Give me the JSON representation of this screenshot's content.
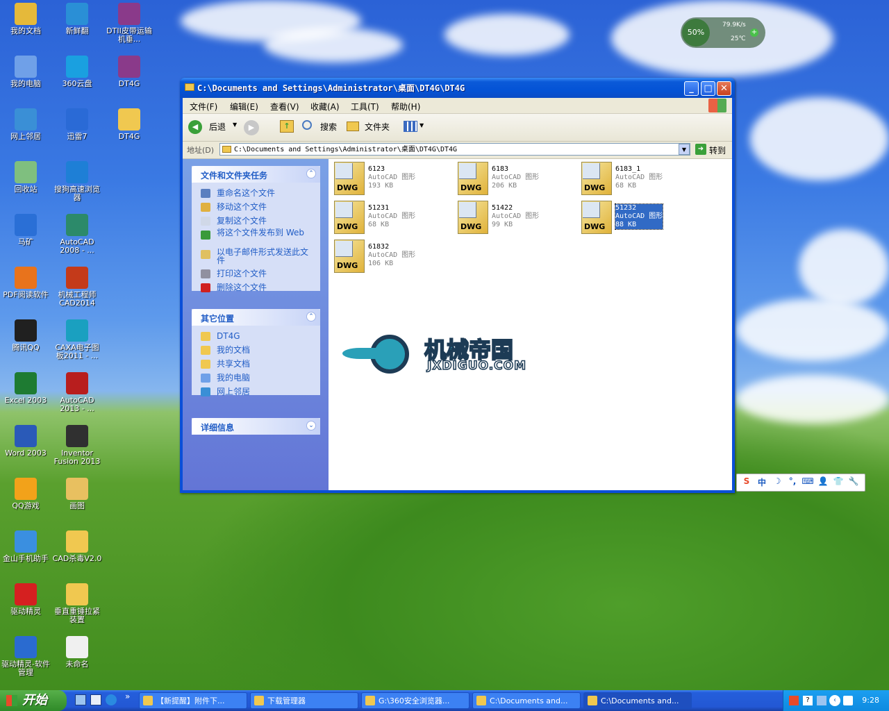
{
  "desktop": {
    "icons_col1": [
      {
        "label": "我的文档",
        "color": "#e5b93a"
      },
      {
        "label": "我的电脑",
        "color": "#6fa0e8"
      },
      {
        "label": "网上邻居",
        "color": "#3a8fd6"
      },
      {
        "label": "回收站",
        "color": "#7fbf7f"
      },
      {
        "label": "马矿",
        "color": "#2a6fd6"
      },
      {
        "label": "PDF阅读软件",
        "color": "#e8731c"
      },
      {
        "label": "腾讯QQ",
        "color": "#202020"
      },
      {
        "label": "Excel 2003",
        "color": "#1e7b32"
      },
      {
        "label": "Word 2003",
        "color": "#2a5ab8"
      },
      {
        "label": "QQ游戏",
        "color": "#f2a21a"
      },
      {
        "label": "金山手机助手",
        "color": "#3a8fe0"
      },
      {
        "label": "驱动精灵",
        "color": "#d52020"
      },
      {
        "label": "驱动精灵-软件管理",
        "color": "#2a6bd0"
      }
    ],
    "icons_col2": [
      {
        "label": "新鲜翻",
        "color": "#2a8fd6"
      },
      {
        "label": "360云盘",
        "color": "#1aa0e0"
      },
      {
        "label": "迅雷7",
        "color": "#2a6ad6"
      },
      {
        "label": "搜狗高速浏览器",
        "color": "#1e7fd6"
      },
      {
        "label": "AutoCAD 2008 - ...",
        "color": "#2c8a6a"
      },
      {
        "label": "机械工程师CAD2014",
        "color": "#c43a1a"
      },
      {
        "label": "CAXA电子图板2011 - ...",
        "color": "#1aa0c0"
      },
      {
        "label": "AutoCAD 2013 - ...",
        "color": "#b81e1e"
      },
      {
        "label": "Inventor Fusion 2013",
        "color": "#303030"
      },
      {
        "label": "画图",
        "color": "#e8c060"
      },
      {
        "label": "CAD杀毒V2.0",
        "color": "#f0c850"
      },
      {
        "label": "垂直重锤拉紧装置",
        "color": "#f0c850"
      },
      {
        "label": "未命名",
        "color": "#f0f0f0"
      }
    ],
    "icons_col3": [
      {
        "label": "DTII皮带运输机垂...",
        "color": "#8a3a8a"
      },
      {
        "label": "DT4G",
        "color": "#8a3a8a"
      },
      {
        "label": "DT4G",
        "color": "#f0c850"
      }
    ]
  },
  "gadget": {
    "cpu": "50%",
    "net": "79.9K/s",
    "temp": "25℃"
  },
  "window": {
    "title": "C:\\Documents and Settings\\Administrator\\桌面\\DT4G\\DT4G",
    "menus": [
      "文件(F)",
      "编辑(E)",
      "查看(V)",
      "收藏(A)",
      "工具(T)",
      "帮助(H)"
    ],
    "toolbar": {
      "back": "后退",
      "search": "搜索",
      "folders": "文件夹"
    },
    "address": {
      "label": "地址(D)",
      "value": "C:\\Documents and Settings\\Administrator\\桌面\\DT4G\\DT4G",
      "go": "转到"
    },
    "tasks": {
      "title": "文件和文件夹任务",
      "items": [
        {
          "label": "重命名这个文件",
          "color": "#5a7fc0"
        },
        {
          "label": "移动这个文件",
          "color": "#e0b040"
        },
        {
          "label": "复制这个文件",
          "color": "#d0d8e8"
        },
        {
          "label": "将这个文件发布到 Web",
          "color": "#3a9a3a"
        },
        {
          "label": "以电子邮件形式发送此文件",
          "color": "#e0c060"
        },
        {
          "label": "打印这个文件",
          "color": "#9090a0"
        },
        {
          "label": "删除这个文件",
          "color": "#d02020"
        }
      ]
    },
    "places": {
      "title": "其它位置",
      "items": [
        {
          "label": "DT4G",
          "color": "#f0c850"
        },
        {
          "label": "我的文档",
          "color": "#f0c850"
        },
        {
          "label": "共享文档",
          "color": "#f0c850"
        },
        {
          "label": "我的电脑",
          "color": "#6fa0e8"
        },
        {
          "label": "网上邻居",
          "color": "#3a8fd6"
        }
      ]
    },
    "details": {
      "title": "详细信息"
    },
    "files": [
      {
        "name": "6123",
        "type": "AutoCAD 图形",
        "size": "193 KB"
      },
      {
        "name": "6183",
        "type": "AutoCAD 图形",
        "size": "206 KB"
      },
      {
        "name": "6183_1",
        "type": "AutoCAD 图形",
        "size": "68 KB"
      },
      {
        "name": "51231",
        "type": "AutoCAD 图形",
        "size": "68 KB"
      },
      {
        "name": "51422",
        "type": "AutoCAD 图形",
        "size": "99 KB"
      },
      {
        "name": "51232",
        "type": "AutoCAD 图形",
        "size": "88 KB"
      },
      {
        "name": "61832",
        "type": "AutoCAD 图形",
        "size": "106 KB"
      }
    ],
    "dwg_label": "DWG",
    "watermark": {
      "cn": "机械帝国",
      "en": "JXDIGUO.COM"
    }
  },
  "taskbar": {
    "start": "开始",
    "tasks": [
      "【新提醒】附件下...",
      "下载管理器",
      "G:\\360安全浏览器...",
      "C:\\Documents and...",
      "C:\\Documents and..."
    ],
    "clock": "9:28"
  },
  "ime": {
    "items": [
      "S",
      "中",
      "☽",
      "°,",
      "⌨",
      "👤",
      "👕",
      "🔧"
    ]
  }
}
